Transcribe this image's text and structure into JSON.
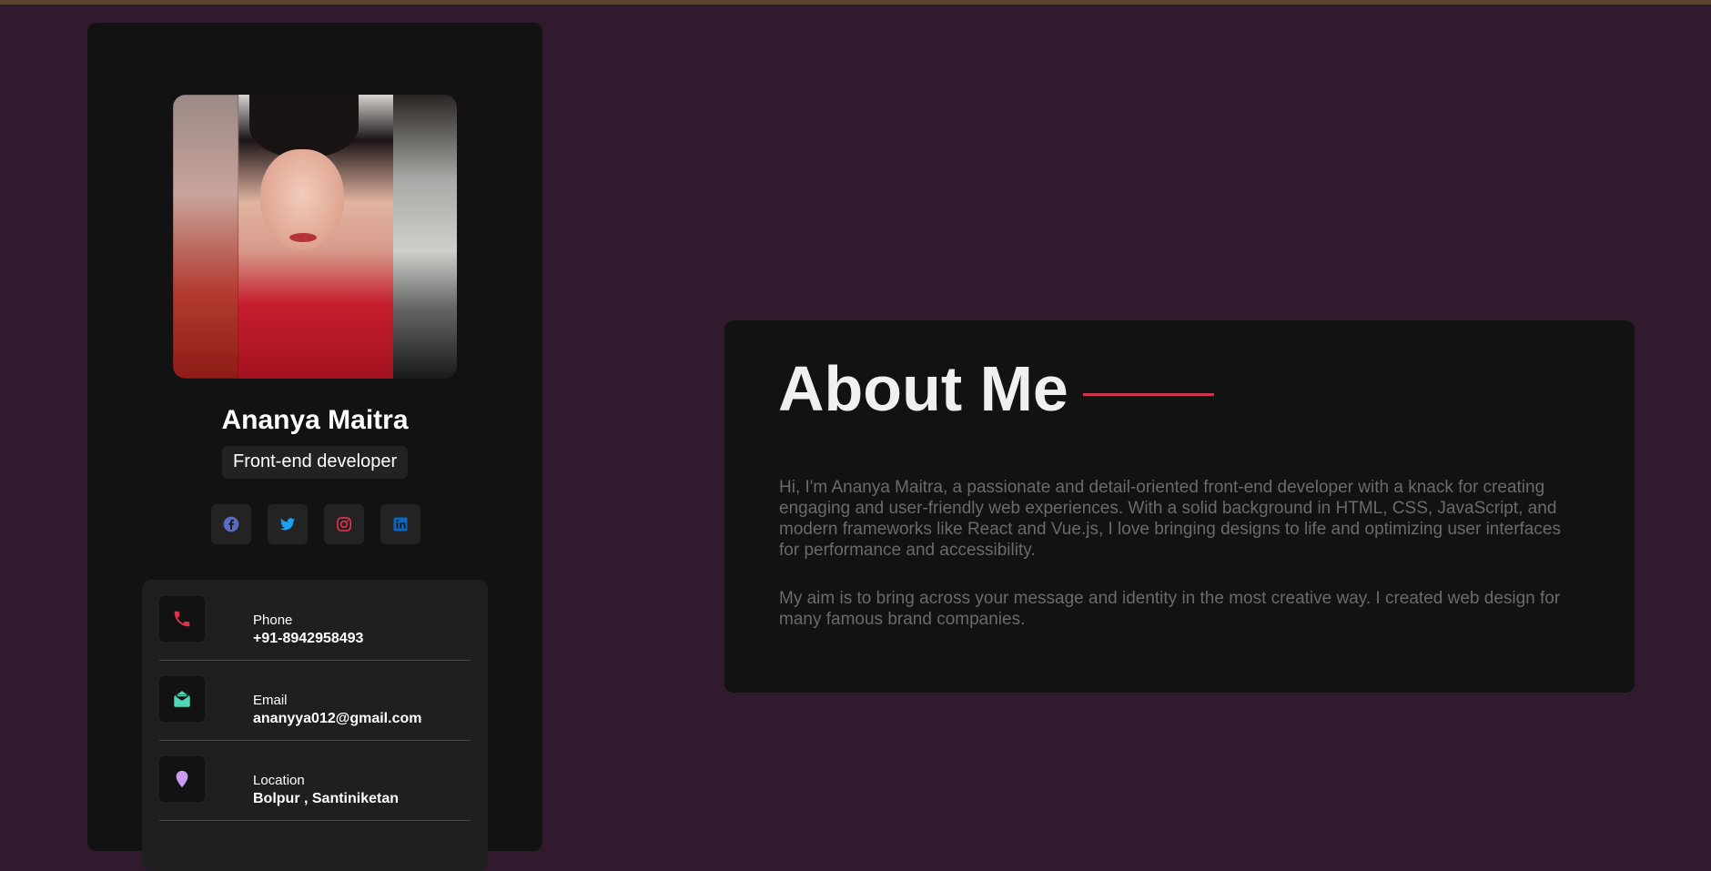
{
  "profile": {
    "name": "Ananya Maitra",
    "role": "Front-end developer"
  },
  "socials": [
    {
      "name": "Facebook",
      "icon": "facebook-icon",
      "color": "#5b6ac2"
    },
    {
      "name": "Twitter",
      "icon": "twitter-icon",
      "color": "#1da1f2"
    },
    {
      "name": "Instagram",
      "icon": "instagram-icon",
      "color": "#e0334b"
    },
    {
      "name": "LinkedIn",
      "icon": "linkedin-icon",
      "color": "#0a66c2"
    }
  ],
  "contacts": [
    {
      "label": "Phone",
      "value": "+91-8942958493",
      "icon": "phone-icon",
      "color": "#e0334b"
    },
    {
      "label": "Email",
      "value": "ananyya012@gmail.com",
      "icon": "envelope-icon",
      "color": "#4ed6b6"
    },
    {
      "label": "Location",
      "value": "Bolpur , Santiniketan",
      "icon": "location-pin-icon",
      "color": "#c89af2"
    }
  ],
  "about": {
    "title": "About Me",
    "paragraphs": [
      "Hi, I'm Ananya Maitra, a passionate and detail-oriented front-end developer with a knack for creating engaging and user-friendly web experiences. With a solid background in HTML, CSS, JavaScript, and modern frameworks like React and Vue.js, I love bringing designs to life and optimizing user interfaces for performance and accessibility.",
      "My aim is to bring across your message and identity in the most creative way. I created web design for many famous brand companies."
    ]
  },
  "theme": {
    "background": "#311a2e",
    "card": "#121212",
    "accent": "#d1344e"
  }
}
